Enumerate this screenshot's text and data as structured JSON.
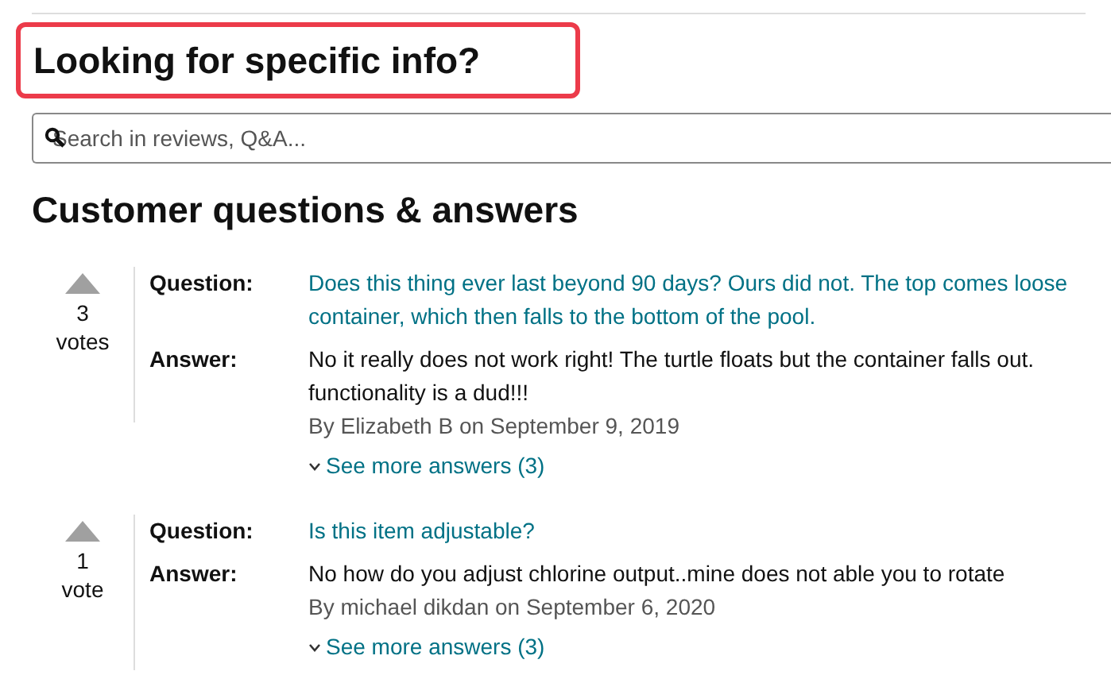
{
  "heading": {
    "text": "Looking for specific info?",
    "highlighted": true
  },
  "search": {
    "placeholder": "Search in reviews, Q&A..."
  },
  "section_title": "Customer questions & answers",
  "questions": [
    {
      "votes": "3",
      "votes_label": "votes",
      "question_label": "Question:",
      "question": "Does this thing ever last beyond 90 days? Ours did not. The top comes loose\ncontainer, which then falls to the bottom of the pool.",
      "answer_label": "Answer:",
      "answer": "No it really does not work right! The turtle floats but the container falls out.\nfunctionality is a dud!!!",
      "byline": "By Elizabeth B on September 9, 2019",
      "more": "See more answers (3)"
    },
    {
      "votes": "1",
      "votes_label": "vote",
      "question_label": "Question:",
      "question": "Is this item adjustable?",
      "answer_label": "Answer:",
      "answer": "No how do you adjust chlorine output..mine does not able you to rotate",
      "byline": "By michael dikdan on September 6, 2020",
      "more": "See more answers (3)"
    }
  ]
}
